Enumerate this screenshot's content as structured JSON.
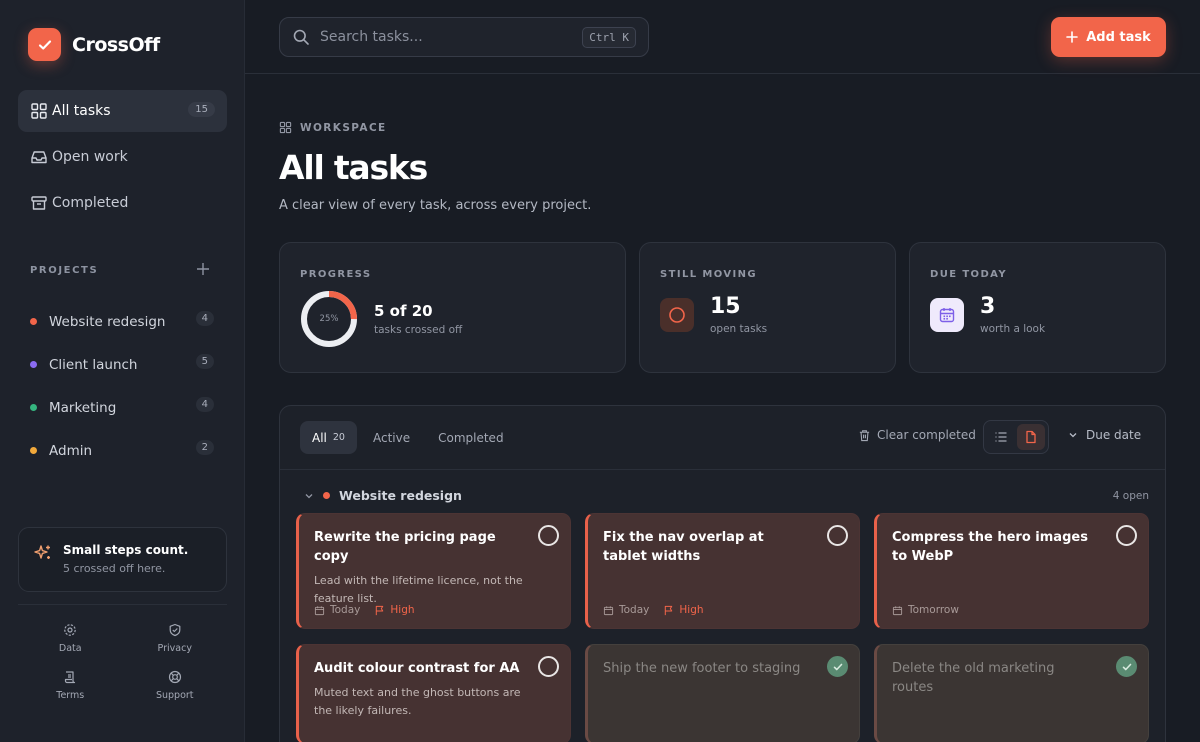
{
  "app": {
    "name": "CrossOff"
  },
  "sidebar": {
    "nav": [
      {
        "label": "All tasks",
        "count": "15",
        "icon": "grid-icon"
      },
      {
        "label": "Open work",
        "icon": "inbox-icon"
      },
      {
        "label": "Completed",
        "icon": "archive-icon"
      }
    ],
    "projects_label": "PROJECTS",
    "projects": [
      {
        "label": "Website redesign",
        "count": "4",
        "color": "#f2654a"
      },
      {
        "label": "Client launch",
        "count": "5",
        "color": "#8b6cf2"
      },
      {
        "label": "Marketing",
        "count": "4",
        "color": "#35b57f"
      },
      {
        "label": "Admin",
        "count": "2",
        "color": "#f2a93b"
      }
    ],
    "tip": {
      "title": "Small steps count.",
      "subtitle": "5 crossed off here."
    },
    "footer": [
      {
        "label": "Data",
        "icon": "gear-icon"
      },
      {
        "label": "Privacy",
        "icon": "shield-icon"
      },
      {
        "label": "Terms",
        "icon": "scroll-icon"
      },
      {
        "label": "Support",
        "icon": "lifebuoy-icon"
      }
    ]
  },
  "topbar": {
    "search_placeholder": "Search tasks...",
    "shortcut": "Ctrl K",
    "add_label": "Add task"
  },
  "header": {
    "eyebrow": "WORKSPACE",
    "title": "All tasks",
    "subtitle": "A clear view of every task, across every project."
  },
  "stats": {
    "progress": {
      "label": "PROGRESS",
      "percent_label": "25%",
      "percent": 0.25,
      "value": "5 of 20",
      "caption": "tasks crossed off"
    },
    "moving": {
      "label": "STILL MOVING",
      "value": "15",
      "caption": "open tasks"
    },
    "due": {
      "label": "DUE TODAY",
      "value": "3",
      "caption": "worth a look"
    }
  },
  "filters": {
    "tabs": [
      {
        "label": "All",
        "count": "20"
      },
      {
        "label": "Active"
      },
      {
        "label": "Completed"
      }
    ],
    "clear_label": "Clear completed",
    "sort_label": "Due date"
  },
  "group": {
    "name": "Website redesign",
    "count": "4 open",
    "color": "#f2654a"
  },
  "tasks": [
    {
      "title": "Rewrite the pricing page copy",
      "desc": "Lead with the lifetime licence, not the feature list.",
      "due": "Today",
      "priority": "High",
      "done": false
    },
    {
      "title": "Fix the nav overlap at tablet widths",
      "desc": "",
      "due": "Today",
      "priority": "High",
      "done": false
    },
    {
      "title": "Compress the hero images to WebP",
      "desc": "",
      "due": "Tomorrow",
      "priority": "",
      "done": false
    },
    {
      "title": "Audit colour contrast for AA",
      "desc": "Muted text and the ghost buttons are the likely failures.",
      "due": "",
      "priority": "",
      "done": false
    },
    {
      "title": "Ship the new footer to staging",
      "desc": "",
      "due": "",
      "priority": "",
      "done": true
    },
    {
      "title": "Delete the old marketing routes",
      "desc": "",
      "due": "",
      "priority": "",
      "done": true
    }
  ]
}
